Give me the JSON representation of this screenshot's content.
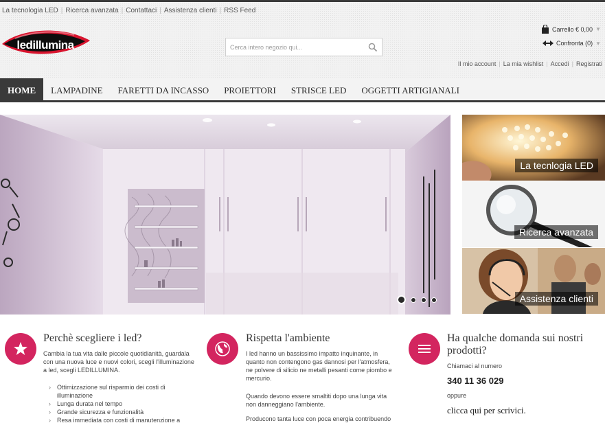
{
  "toplinks": [
    "La tecnologia LED",
    "Ricerca avanzata",
    "Contattaci",
    "Assistenza clienti",
    "RSS Feed"
  ],
  "logo": {
    "text": "ledillumina"
  },
  "search": {
    "placeholder": "Cerca intero negozio qui...",
    "icon": "search-icon"
  },
  "cart": {
    "label": "Carrello € 0,00",
    "icon": "shopping-bag-icon"
  },
  "compare": {
    "label": "Confronta (0)",
    "icon": "compare-arrows-icon"
  },
  "account_links": [
    "Il mio account",
    "La mia wishlist",
    "Accedi",
    "Registrati"
  ],
  "nav": [
    "HOME",
    "LAMPADINE",
    "FARETTI DA INCASSO",
    "PROIETTORI",
    "STRISCE LED",
    "OGGETTI ARTIGIANALI"
  ],
  "slider": {
    "dots": 4,
    "active_dot": 1
  },
  "promos": [
    "La tecnlogia LED",
    "Ricerca avanzata",
    "Assistenza clienti"
  ],
  "col1": {
    "icon": "star-icon",
    "title": "Perchè scegliere i led?",
    "text": "Cambia la tua vita dalle piccole quotidianità, guardala con una nuova luce e nuovi colori, scegli l'illuminazione a led, scegli LEDILLUMINA.",
    "bullets": [
      "Ottimizzazione sul risparmio dei costi di illuminazione",
      "Lunga durata nel tempo",
      "Grande sicurezza e funzionalità",
      "Resa immediata con costi di manutenzione a"
    ]
  },
  "col2": {
    "icon": "globe-icon",
    "title": "Rispetta l'ambiente",
    "p1": "I led hanno un bassissimo impatto inquinante, in quanto non contengono gas dannosi per l'atmosfera, ne polvere di silicio ne metalli pesanti come piombo e mercurio.",
    "p2": "Quando devono essere smaltiti dopo una lunga vita non danneggiano l'ambiente.",
    "p3": "Producono tanta luce con poca energia contribuendo"
  },
  "col3": {
    "icon": "menu-lines-icon",
    "title": "Ha qualche domanda sui nostri prodotti?",
    "call": "Chiamaci al numero",
    "phone": "340 11 36 029",
    "or": "oppure",
    "write": "clicca qui per scrivici."
  },
  "colors": {
    "accent": "#d3255f",
    "dark": "#3a3a3a"
  }
}
